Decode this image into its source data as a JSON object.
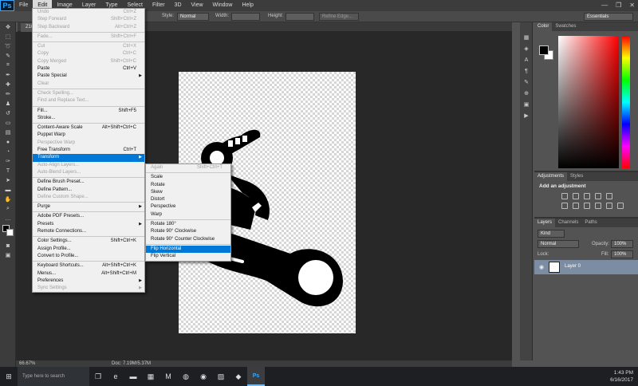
{
  "menubar": {
    "logo": "Ps",
    "items": [
      "File",
      "Edit",
      "Image",
      "Layer",
      "Type",
      "Select",
      "Filter",
      "3D",
      "View",
      "Window",
      "Help"
    ],
    "active": "Edit"
  },
  "window_controls": [
    "—",
    "❐",
    "✕"
  ],
  "options_bar": {
    "style_label": "Style:",
    "style_value": "Normal",
    "width_label": "Width:",
    "height_label": "Height:",
    "refine_button": "Refine Edge...",
    "workspace": "Essentials"
  },
  "document": {
    "tab_label": "Z10",
    "zoom": "66.67%",
    "doc_size": "Doc: 7.19M/5.37M"
  },
  "edit_menu": [
    {
      "label": "Undo",
      "shortcut": "Ctrl+Z",
      "disabled": true
    },
    {
      "label": "Step Forward",
      "shortcut": "Shift+Ctrl+Z",
      "disabled": true
    },
    {
      "label": "Step Backward",
      "shortcut": "Alt+Ctrl+Z",
      "disabled": true
    },
    {
      "sep": true
    },
    {
      "label": "Fade...",
      "shortcut": "Shift+Ctrl+F",
      "disabled": true
    },
    {
      "sep": true
    },
    {
      "label": "Cut",
      "shortcut": "Ctrl+X",
      "disabled": true
    },
    {
      "label": "Copy",
      "shortcut": "Ctrl+C",
      "disabled": true
    },
    {
      "label": "Copy Merged",
      "shortcut": "Shift+Ctrl+C",
      "disabled": true
    },
    {
      "label": "Paste",
      "shortcut": "Ctrl+V"
    },
    {
      "label": "Paste Special",
      "submenu": true
    },
    {
      "label": "Clear",
      "disabled": true
    },
    {
      "sep": true
    },
    {
      "label": "Check Spelling...",
      "disabled": true
    },
    {
      "label": "Find and Replace Text...",
      "disabled": true
    },
    {
      "sep": true
    },
    {
      "label": "Fill...",
      "shortcut": "Shift+F5"
    },
    {
      "label": "Stroke..."
    },
    {
      "sep": true
    },
    {
      "label": "Content-Aware Scale",
      "shortcut": "Alt+Shift+Ctrl+C"
    },
    {
      "label": "Puppet Warp"
    },
    {
      "label": "Perspective Warp",
      "disabled": true
    },
    {
      "label": "Free Transform",
      "shortcut": "Ctrl+T"
    },
    {
      "label": "Transform",
      "submenu": true,
      "highlighted": true
    },
    {
      "label": "Auto-Align Layers...",
      "disabled": true
    },
    {
      "label": "Auto-Blend Layers...",
      "disabled": true
    },
    {
      "sep": true
    },
    {
      "label": "Define Brush Preset..."
    },
    {
      "label": "Define Pattern..."
    },
    {
      "label": "Define Custom Shape...",
      "disabled": true
    },
    {
      "sep": true
    },
    {
      "label": "Purge",
      "submenu": true
    },
    {
      "sep": true
    },
    {
      "label": "Adobe PDF Presets..."
    },
    {
      "label": "Presets",
      "submenu": true
    },
    {
      "label": "Remote Connections..."
    },
    {
      "sep": true
    },
    {
      "label": "Color Settings...",
      "shortcut": "Shift+Ctrl+K"
    },
    {
      "label": "Assign Profile..."
    },
    {
      "label": "Convert to Profile..."
    },
    {
      "sep": true
    },
    {
      "label": "Keyboard Shortcuts...",
      "shortcut": "Alt+Shift+Ctrl+K"
    },
    {
      "label": "Menus...",
      "shortcut": "Alt+Shift+Ctrl+M"
    },
    {
      "label": "Preferences",
      "submenu": true
    },
    {
      "label": "Sync Settings",
      "submenu": true,
      "disabled": true
    }
  ],
  "transform_menu": [
    {
      "label": "Again",
      "shortcut": "Shift+Ctrl+T",
      "disabled": true
    },
    {
      "sep": true
    },
    {
      "label": "Scale"
    },
    {
      "label": "Rotate"
    },
    {
      "label": "Skew"
    },
    {
      "label": "Distort"
    },
    {
      "label": "Perspective"
    },
    {
      "label": "Warp"
    },
    {
      "sep": true
    },
    {
      "label": "Rotate 180°"
    },
    {
      "label": "Rotate 90° Clockwise"
    },
    {
      "label": "Rotate 90° Counter Clockwise"
    },
    {
      "sep": true
    },
    {
      "label": "Flip Horizontal",
      "highlighted": true
    },
    {
      "label": "Flip Vertical"
    }
  ],
  "panels": {
    "color_tabs": [
      "Color",
      "Swatches"
    ],
    "adjust_tabs": [
      "Adjustments",
      "Styles"
    ],
    "adjust_title": "Add an adjustment",
    "layers_tabs": [
      "Layers",
      "Channels",
      "Paths"
    ],
    "kind_filter": "Kind",
    "blend_mode": "Normal",
    "opacity_label": "Opacity:",
    "opacity_value": "100%",
    "lock_label": "Lock:",
    "fill_label": "Fill:",
    "fill_value": "100%",
    "layer_name": "Layer 0"
  },
  "taskbar": {
    "search_placeholder": "Type here to search",
    "time": "1:43 PM",
    "date": "6/16/2017"
  }
}
